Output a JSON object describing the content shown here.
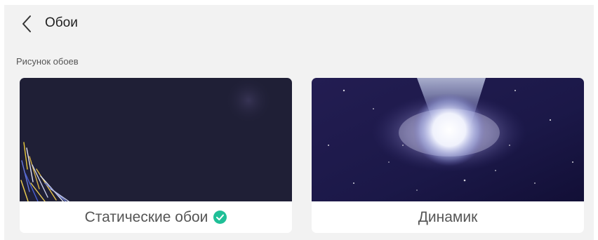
{
  "header": {
    "title": "Обои",
    "back_icon": "chevron-left-icon"
  },
  "section": {
    "label": "Рисунок обоев"
  },
  "cards": [
    {
      "label": "Статические обои",
      "selected": true,
      "status_icon": "check-circle-icon",
      "accent_color": "#1fbf97"
    },
    {
      "label": "Динамик",
      "selected": false
    }
  ],
  "colors": {
    "background": "#f2f2f2",
    "card": "#ffffff",
    "static_wallpaper": "#1f1f36",
    "dynamic_wallpaper": "#1b1848"
  }
}
